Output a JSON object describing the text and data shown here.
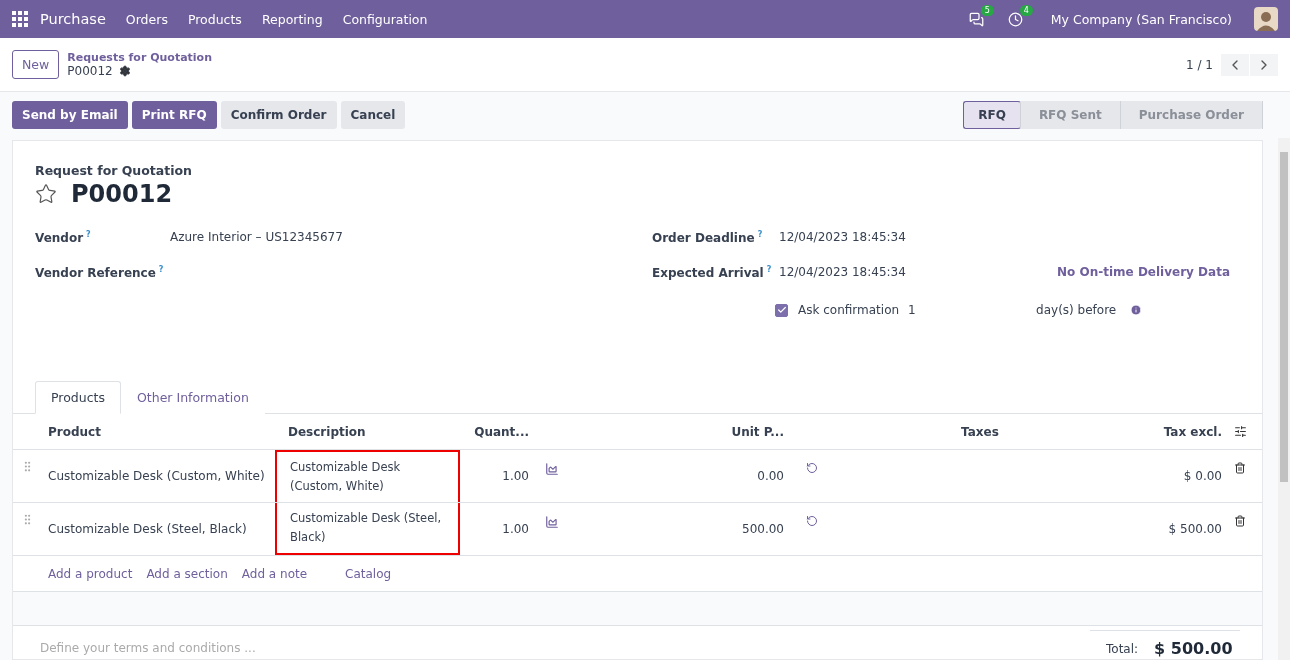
{
  "navbar": {
    "app": "Purchase",
    "menu": [
      "Orders",
      "Products",
      "Reporting",
      "Configuration"
    ],
    "messages_count": "5",
    "activities_count": "4",
    "company": "My Company (San Francisco)"
  },
  "control_panel": {
    "new_button": "New",
    "breadcrumb": "Requests for Quotation",
    "record": "P00012",
    "pager": "1 / 1"
  },
  "actions": [
    {
      "label": "Send by Email",
      "primary": true
    },
    {
      "label": "Print RFQ",
      "primary": true
    },
    {
      "label": "Confirm Order",
      "primary": false
    },
    {
      "label": "Cancel",
      "primary": false
    }
  ],
  "statusbar": [
    {
      "label": "RFQ",
      "selected": true
    },
    {
      "label": "RFQ Sent",
      "selected": false
    },
    {
      "label": "Purchase Order",
      "selected": false
    }
  ],
  "form": {
    "subtitle": "Request for Quotation",
    "title": "P00012",
    "starred": false,
    "left_fields": [
      {
        "label": "Vendor",
        "help": "?",
        "value": "Azure Interior – US12345677"
      },
      {
        "label": "Vendor Reference",
        "help": "?"
      }
    ],
    "right_fields": [
      {
        "label": "Order Deadline",
        "help": "?",
        "value": "12/04/2023 18:45:34"
      },
      {
        "label": "Expected Arrival",
        "help": "?",
        "value": "12/04/2023 18:45:34",
        "extra": "No On-time Delivery Data"
      }
    ],
    "ask_confirmation": {
      "checked": true,
      "label": "Ask confirmation",
      "days": "1",
      "suffix": "day(s) before"
    }
  },
  "tabs": [
    {
      "label": "Products",
      "selected": true
    },
    {
      "label": "Other Information",
      "selected": false
    }
  ],
  "table": {
    "columns": [
      {
        "label": "Product"
      },
      {
        "label": "Description"
      },
      {
        "label": "Quant..."
      },
      {
        "label": "Unit P..."
      },
      {
        "label": "Taxes"
      },
      {
        "label": "Tax excl."
      }
    ],
    "description_highlighted": true,
    "rows": [
      {
        "product": "Customizable Desk (Custom, White)",
        "description": "Customizable Desk (Custom, White)",
        "quantity": "1.00",
        "unit_price": "0.00",
        "subtotal": "$ 0.00"
      },
      {
        "product": "Customizable Desk (Steel, Black)",
        "description": "Customizable Desk (Steel, Black)",
        "quantity": "1.00",
        "unit_price": "500.00",
        "subtotal": "$ 500.00"
      }
    ],
    "add_links": [
      "Add a product",
      "Add a section",
      "Add a note",
      "Catalog"
    ]
  },
  "terms": {
    "placeholder": "Define your terms and conditions ..."
  },
  "total": {
    "label": "Total:",
    "value": "$ 500.00"
  }
}
